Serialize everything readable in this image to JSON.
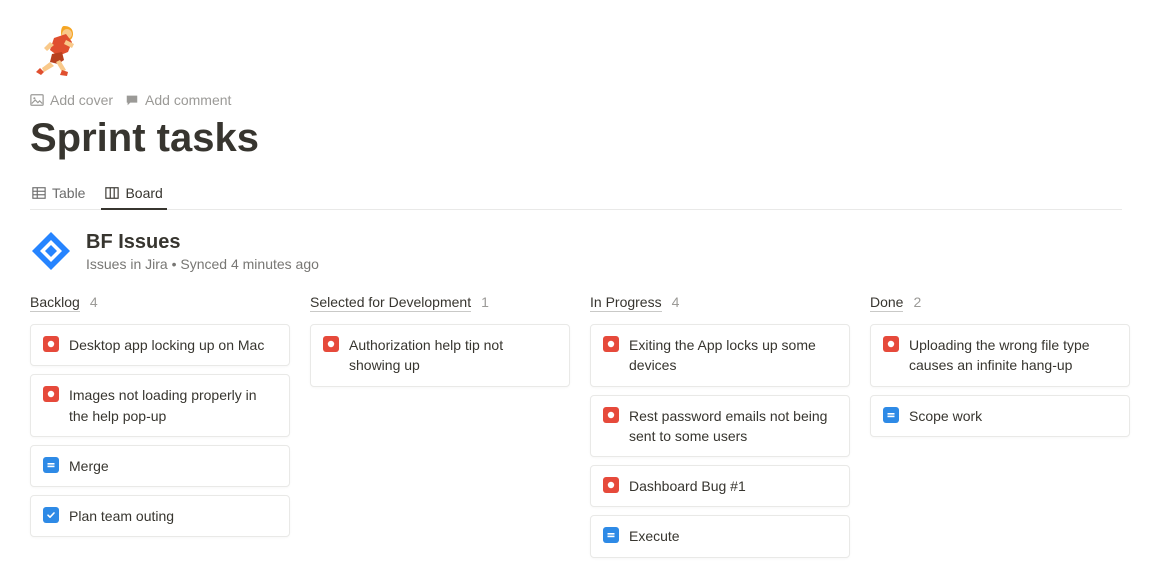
{
  "page": {
    "emoji": "🏃",
    "addCover": "Add cover",
    "addComment": "Add comment",
    "title": "Sprint tasks"
  },
  "tabs": {
    "table": "Table",
    "board": "Board"
  },
  "db": {
    "title": "BF Issues",
    "sub": "Issues in Jira • Synced 4 minutes ago"
  },
  "columns": [
    {
      "name": "Backlog",
      "count": "4",
      "cards": [
        {
          "icon": "bug",
          "title": "Desktop app locking up on Mac"
        },
        {
          "icon": "bug",
          "title": "Images not loading properly in the help pop-up"
        },
        {
          "icon": "task",
          "title": "Merge"
        },
        {
          "icon": "check",
          "title": "Plan team outing"
        }
      ]
    },
    {
      "name": "Selected for Development",
      "count": "1",
      "cards": [
        {
          "icon": "bug",
          "title": "Authorization help tip not showing up"
        }
      ]
    },
    {
      "name": "In Progress",
      "count": "4",
      "cards": [
        {
          "icon": "bug",
          "title": "Exiting the App locks up some devices"
        },
        {
          "icon": "bug",
          "title": "Rest password emails not being sent to some users"
        },
        {
          "icon": "bug",
          "title": "Dashboard Bug #1"
        },
        {
          "icon": "task",
          "title": "Execute"
        }
      ]
    },
    {
      "name": "Done",
      "count": "2",
      "cards": [
        {
          "icon": "bug",
          "title": "Uploading the wrong file type causes an infinite hang-up"
        },
        {
          "icon": "task",
          "title": "Scope work"
        }
      ]
    }
  ]
}
